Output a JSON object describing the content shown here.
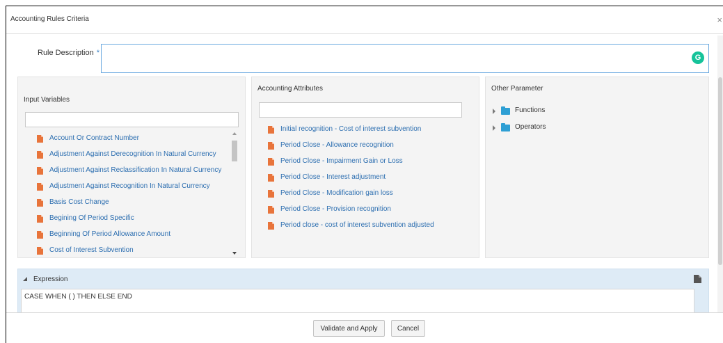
{
  "dialog": {
    "title": "Accounting Rules Criteria",
    "close_glyph": "×"
  },
  "rule": {
    "label": "Rule Description",
    "required_mark": "*",
    "value": "",
    "grammarly_glyph": "G"
  },
  "input_variables": {
    "title": "Input Variables",
    "items": [
      "Account Or Contract Number",
      "Adjustment Against Derecognition In Natural Currency",
      "Adjustment Against Reclassification In Natural Currency",
      "Adjustment Against Recognition In Natural Currency",
      "Basis Cost Change",
      "Begining Of Period Specific",
      "Beginning Of Period Allowance Amount",
      "Cost of Interest Subvention"
    ]
  },
  "accounting_attributes": {
    "title": "Accounting Attributes",
    "items": [
      "Initial recognition - Cost of interest subvention",
      "Period Close - Allowance recognition",
      "Period Close - Impairment Gain or Loss",
      "Period Close - Interest adjustment",
      "Period Close - Modification gain loss",
      "Period Close - Provision recognition",
      "Period close - cost of interest subvention adjusted"
    ]
  },
  "other_parameter": {
    "title": "Other Parameter",
    "nodes": [
      "Functions",
      "Operators"
    ]
  },
  "expression": {
    "title": "Expression",
    "value": "CASE WHEN ( ) THEN ELSE END"
  },
  "footer": {
    "validate_label": "Validate and Apply",
    "cancel_label": "Cancel"
  },
  "colors": {
    "link": "#2c6eb0",
    "doc_icon": "#e8743b",
    "folder_icon": "#2e9fd4",
    "expression_bg": "#deebf6",
    "input_focus_border": "#6aa9e0"
  },
  "icons": {
    "item": "file-icon",
    "tree": "folder-icon",
    "expression_action": "document-icon"
  }
}
